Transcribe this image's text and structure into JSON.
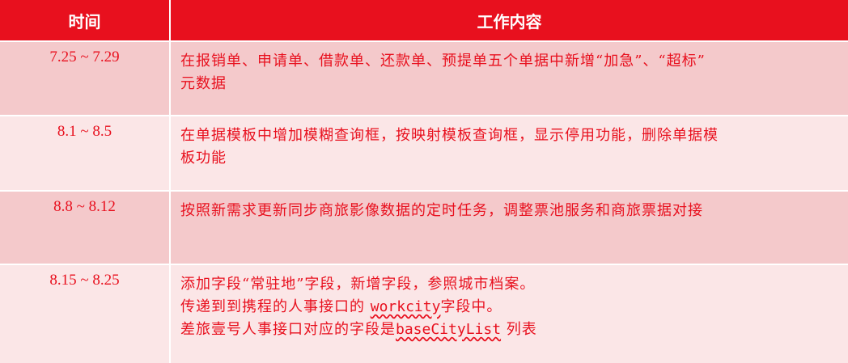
{
  "header": {
    "time": "时间",
    "work": "工作内容"
  },
  "rows": [
    {
      "time": "7.25 ~ 7.29",
      "lines": [
        "在报销单、申请单、借款单、还款单、预提单五个单据中新增“加急”、“超标”",
        "元数据"
      ]
    },
    {
      "time": "8.1 ~ 8.5",
      "lines": [
        "在单据模板中增加模糊查询框，按映射模板查询框，显示停用功能，删除单据模",
        "板功能"
      ]
    },
    {
      "time": "8.8 ~ 8.12",
      "lines": [
        "按照新需求更新同步商旅影像数据的定时任务，调整票池服务和商旅票据对接"
      ]
    },
    {
      "time": "8.15 ~ 8.25",
      "line1": "添加字段“常驻地”字段，新增字段，参照城市档案。",
      "line2_a": "传递到到携程的人事接口的 ",
      "line2_code": "workcity",
      "line2_b": "字段中。",
      "line3_a": "差旅壹号人事接口对应的字段是",
      "line3_code": "baseCityList",
      "line3_b": " 列表"
    }
  ],
  "colors": {
    "header_bg": "#e8101e",
    "row_dark": "#f4c9cb",
    "row_light": "#fbe6e7",
    "text": "#e8101e"
  }
}
